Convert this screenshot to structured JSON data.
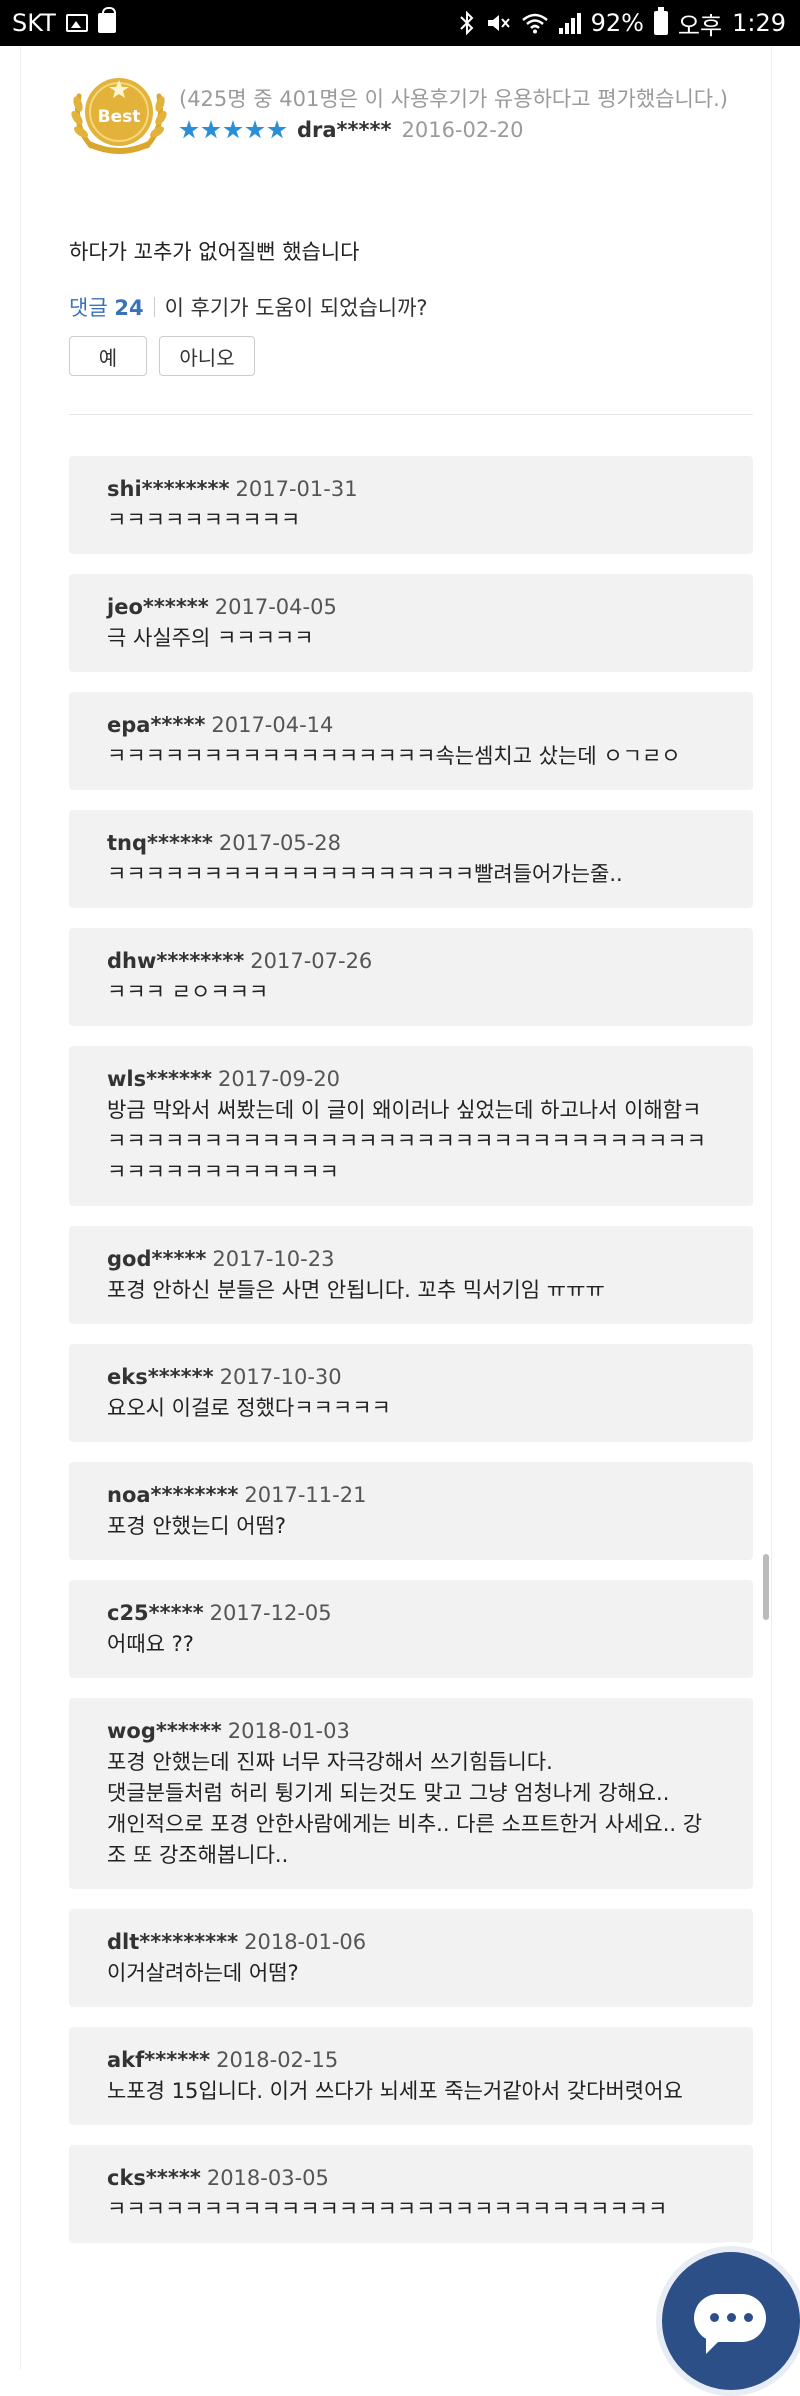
{
  "status_bar": {
    "carrier": "SKT",
    "battery": "92%",
    "ampm": "오후",
    "time": "1:29",
    "left_icons": [
      "image-icon",
      "shopping-bag-icon"
    ],
    "right_icons": [
      "bluetooth-icon",
      "mute-icon",
      "wifi-icon",
      "signal-icon",
      "battery-icon"
    ]
  },
  "review": {
    "badge": "Best",
    "helpful_note": "(425명 중 401명은 이 사용후기가 유용하다고 평가했습니다.)",
    "stars": 5,
    "author": "dra*****",
    "date": "2016-02-20",
    "body": "하다가 꼬추가 없어질뻔 했습니다",
    "comment_label": "댓글",
    "comment_count": "24",
    "question": "이 후기가 도움이 되었습니까?",
    "yes_label": "예",
    "no_label": "아니오"
  },
  "colors": {
    "accent_blue": "#3a72b8",
    "star_blue": "#2a8fd6",
    "badge_gold": "#e2b23a",
    "comment_bg": "#f2f2f2",
    "fab_blue": "#2b4f86"
  },
  "comments": [
    {
      "user": "shi********",
      "date": "2017-01-31",
      "text": "ㅋㅋㅋㅋㅋㅋㅋㅋㅋㅋ"
    },
    {
      "user": "jeo******",
      "date": "2017-04-05",
      "text": "극 사실주의 ㅋㅋㅋㅋㅋ"
    },
    {
      "user": "epa*****",
      "date": "2017-04-14",
      "text": "ㅋㅋㅋㅋㅋㅋㅋㅋㅋㅋㅋㅋㅋㅋㅋㅋㅋ속는셈치고 샀는데 ㅇㄱㄹㅇ"
    },
    {
      "user": "tnq******",
      "date": "2017-05-28",
      "text": "ㅋㅋㅋㅋㅋㅋㅋㅋㅋㅋㅋㅋㅋㅋㅋㅋㅋㅋㅋ빨려들어가는줄.."
    },
    {
      "user": "dhw********",
      "date": "2017-07-26",
      "text": "ㅋㅋㅋ ㄹㅇㅋㅋㅋ"
    },
    {
      "user": "wls******",
      "date": "2017-09-20",
      "text": "방금 막와서 써봤는데 이 글이 왜이러나 싶었는데 하고나서 이해함ㅋㅋㅋㅋㅋㅋㅋㅋㅋㅋㅋㅋㅋㅋㅋㅋㅋㅋㅋㅋㅋㅋㅋㅋㅋㅋㅋㅋㅋㅋㅋㅋㅋㅋㅋㅋㅋㅋㅋㅋㅋㅋㅋㅋ"
    },
    {
      "user": "god*****",
      "date": "2017-10-23",
      "text": "포경 안하신 분들은 사면 안됩니다. 꼬추 믹서기임 ㅠㅠㅠ"
    },
    {
      "user": "eks******",
      "date": "2017-10-30",
      "text": "요오시 이걸로 정했다ㅋㅋㅋㅋㅋ"
    },
    {
      "user": "noa********",
      "date": "2017-11-21",
      "text": "포경 안했는디 어떰?"
    },
    {
      "user": "c25*****",
      "date": "2017-12-05",
      "text": "어때요 ??"
    },
    {
      "user": "wog******",
      "date": "2018-01-03",
      "text": "포경 안했는데 진짜 너무 자극강해서 쓰기힘듭니다.\n댓글분들처럼 허리 튕기게 되는것도 맞고 그냥 엄청나게 강해요..\n개인적으로 포경 안한사람에게는 비추.. 다른 소프트한거 사세요.. 강조 또 강조해봅니다.."
    },
    {
      "user": "dlt*********",
      "date": "2018-01-06",
      "text": "이거살려하는데 어떰?"
    },
    {
      "user": "akf******",
      "date": "2018-02-15",
      "text": "노포경 15입니다. 이거 쓰다가 뇌세포 죽는거같아서 갖다버렷어요"
    },
    {
      "user": "cks*****",
      "date": "2018-03-05",
      "text": "ㅋㅋㅋㅋㅋㅋㅋㅋㅋㅋㅋㅋㅋㅋㅋㅋㅋㅋㅋㅋㅋㅋㅋㅋㅋㅋㅋㅋㅋ"
    }
  ]
}
